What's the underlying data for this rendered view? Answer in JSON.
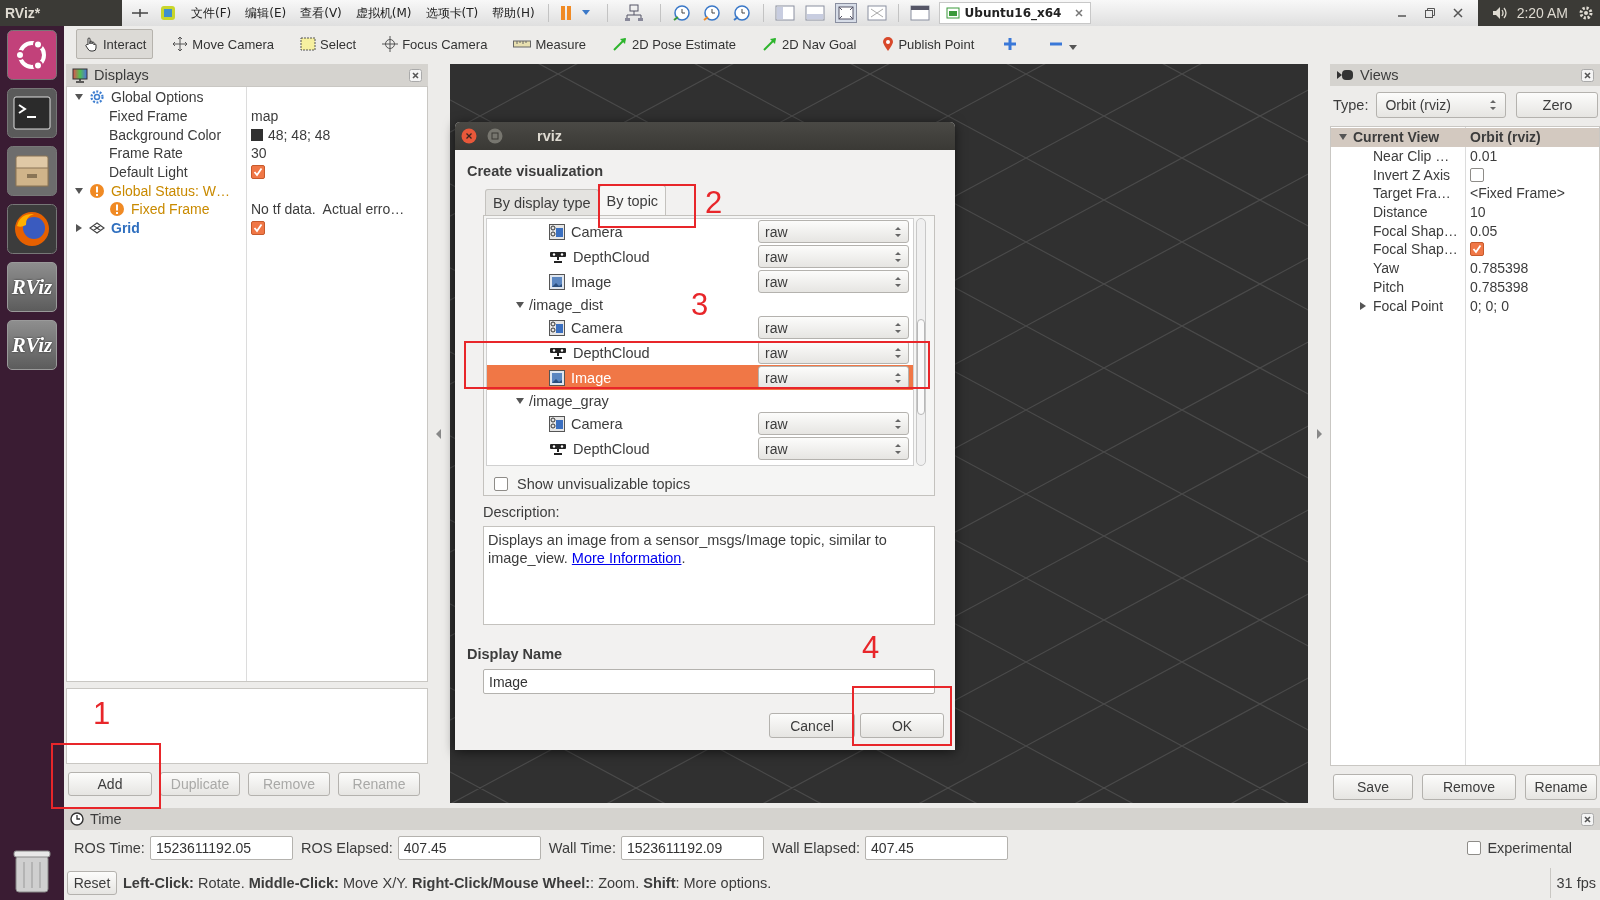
{
  "top_bar": {
    "app_title": "RViz*",
    "vm_menu": [
      "文件(F)",
      "编辑(E)",
      "查看(V)",
      "虚拟机(M)",
      "选项卡(T)",
      "帮助(H)"
    ],
    "vm_tab": "Ubuntu16_x64",
    "clock": "2:20 AM"
  },
  "launcher": [
    {
      "kind": "ubuntu"
    },
    {
      "kind": "terminal"
    },
    {
      "kind": "files"
    },
    {
      "kind": "firefox"
    },
    {
      "kind": "rviz",
      "label": "RViz"
    },
    {
      "kind": "rviz",
      "label": "RViz"
    },
    {
      "kind": "trash"
    }
  ],
  "toolbar": {
    "tools": [
      {
        "kind": "interact",
        "label": "Interact",
        "selected": true
      },
      {
        "kind": "camera",
        "label": "Move Camera",
        "selected": false
      },
      {
        "kind": "select",
        "label": "Select",
        "selected": false
      },
      {
        "kind": "focus",
        "label": "Focus Camera",
        "selected": false
      },
      {
        "kind": "measure",
        "label": "Measure",
        "selected": false
      },
      {
        "kind": "pose",
        "label": "2D Pose Estimate",
        "selected": false
      },
      {
        "kind": "goal",
        "label": "2D Nav Goal",
        "selected": false
      },
      {
        "kind": "point",
        "label": "Publish Point",
        "selected": false
      }
    ],
    "actions": [
      {
        "kind": "add"
      },
      {
        "kind": "remove"
      }
    ]
  },
  "displays": {
    "title": "Displays",
    "tree": [
      {
        "kind": "options",
        "label": "Global Options",
        "expanded": true,
        "children": [
          {
            "label": "Fixed Frame",
            "value": "map"
          },
          {
            "kind": "color",
            "label": "Background Color",
            "value": "48; 48; 48"
          },
          {
            "label": "Frame Rate",
            "value": "30"
          },
          {
            "label": "Default Light",
            "checked": true
          }
        ]
      },
      {
        "kind": "warning",
        "label": "Global Status: W…",
        "expanded": true,
        "children": [
          {
            "kind": "warning",
            "label": "Fixed Frame",
            "value": "No tf data.  Actual erro…"
          }
        ]
      },
      {
        "kind": "display",
        "label": "Grid",
        "expanded": false,
        "checked": true
      }
    ],
    "buttons": [
      {
        "label": "Add",
        "disabled": false
      },
      {
        "label": "Duplicate",
        "disabled": true
      },
      {
        "label": "Remove",
        "disabled": true
      },
      {
        "label": "Rename",
        "disabled": true
      }
    ]
  },
  "views": {
    "title": "Views",
    "type_label": "Type:",
    "type_value": "Orbit (rviz)",
    "zero_button": "Zero",
    "tree": [
      {
        "kind": "header",
        "label": "Current View",
        "value": "Orbit (rviz)",
        "expanded": true,
        "children": [
          {
            "label": "Near Clip …",
            "value": "0.01"
          },
          {
            "label": "Invert Z Axis",
            "checked": false
          },
          {
            "label": "Target Fra…",
            "value": "<Fixed Frame>"
          },
          {
            "label": "Distance",
            "value": "10"
          },
          {
            "label": "Focal Shap…",
            "value": "0.05"
          },
          {
            "label": "Focal Shap…",
            "checked": true
          },
          {
            "label": "Yaw",
            "value": "0.785398"
          },
          {
            "label": "Pitch",
            "value": "0.785398"
          },
          {
            "label": "Focal Point",
            "value": "0; 0; 0",
            "expanded": false
          }
        ]
      }
    ],
    "buttons": [
      "Save",
      "Remove",
      "Rename"
    ]
  },
  "time_panel": {
    "title": "Time",
    "fields": [
      {
        "label": "ROS Time:",
        "value": "1523611192.05"
      },
      {
        "label": "ROS Elapsed:",
        "value": "407.45"
      },
      {
        "label": "Wall Time:",
        "value": "1523611192.09"
      },
      {
        "label": "Wall Elapsed:",
        "value": "407.45"
      }
    ],
    "experimental": {
      "label": "Experimental",
      "checked": false
    }
  },
  "status_bar": {
    "reset": "Reset",
    "hint": "**Left-Click:** Rotate. **Middle-Click:** Move X/Y. **Right-Click/Mouse Wheel:**: Zoom. **Shift**: More options.",
    "fps": "31 fps"
  },
  "dialog": {
    "title": "rviz",
    "heading": "Create visualization",
    "tabs": [
      {
        "label": "By display type",
        "selected": false
      },
      {
        "label": "By topic",
        "selected": true
      }
    ],
    "topics": [
      {
        "kind": "camera",
        "label": "Camera",
        "transport": "raw",
        "selected": false
      },
      {
        "kind": "depthcloud",
        "label": "DepthCloud",
        "transport": "raw",
        "selected": false
      },
      {
        "kind": "image",
        "label": "Image",
        "transport": "raw",
        "selected": false
      },
      {
        "kind": "topic",
        "label": "/image_dist",
        "expanded": true,
        "selected": false,
        "children": [
          {
            "kind": "camera",
            "label": "Camera",
            "transport": "raw",
            "selected": false
          },
          {
            "kind": "depthcloud",
            "label": "DepthCloud",
            "transport": "raw",
            "selected": false
          },
          {
            "kind": "image",
            "label": "Image",
            "transport": "raw",
            "selected": true
          }
        ]
      },
      {
        "kind": "topic",
        "label": "/image_gray",
        "expanded": true,
        "selected": false,
        "children": [
          {
            "kind": "camera",
            "label": "Camera",
            "transport": "raw",
            "selected": false
          },
          {
            "kind": "depthcloud",
            "label": "DepthCloud",
            "transport": "raw",
            "selected": false
          }
        ]
      }
    ],
    "show_unvisualizable": {
      "label": "Show unvisualizable topics",
      "checked": false
    },
    "description_label": "Description:",
    "description": "Displays an image from a sensor_msgs/Image topic, similar to image_view. ",
    "description_link": "More Information",
    "description_end": ".",
    "display_name_label": "Display Name",
    "display_name": "Image",
    "buttons": [
      {
        "label": "Cancel"
      },
      {
        "label": "OK"
      }
    ]
  },
  "annotations": [
    {
      "label": "1"
    },
    {
      "label": "2"
    },
    {
      "label": "3"
    },
    {
      "label": "4"
    }
  ]
}
